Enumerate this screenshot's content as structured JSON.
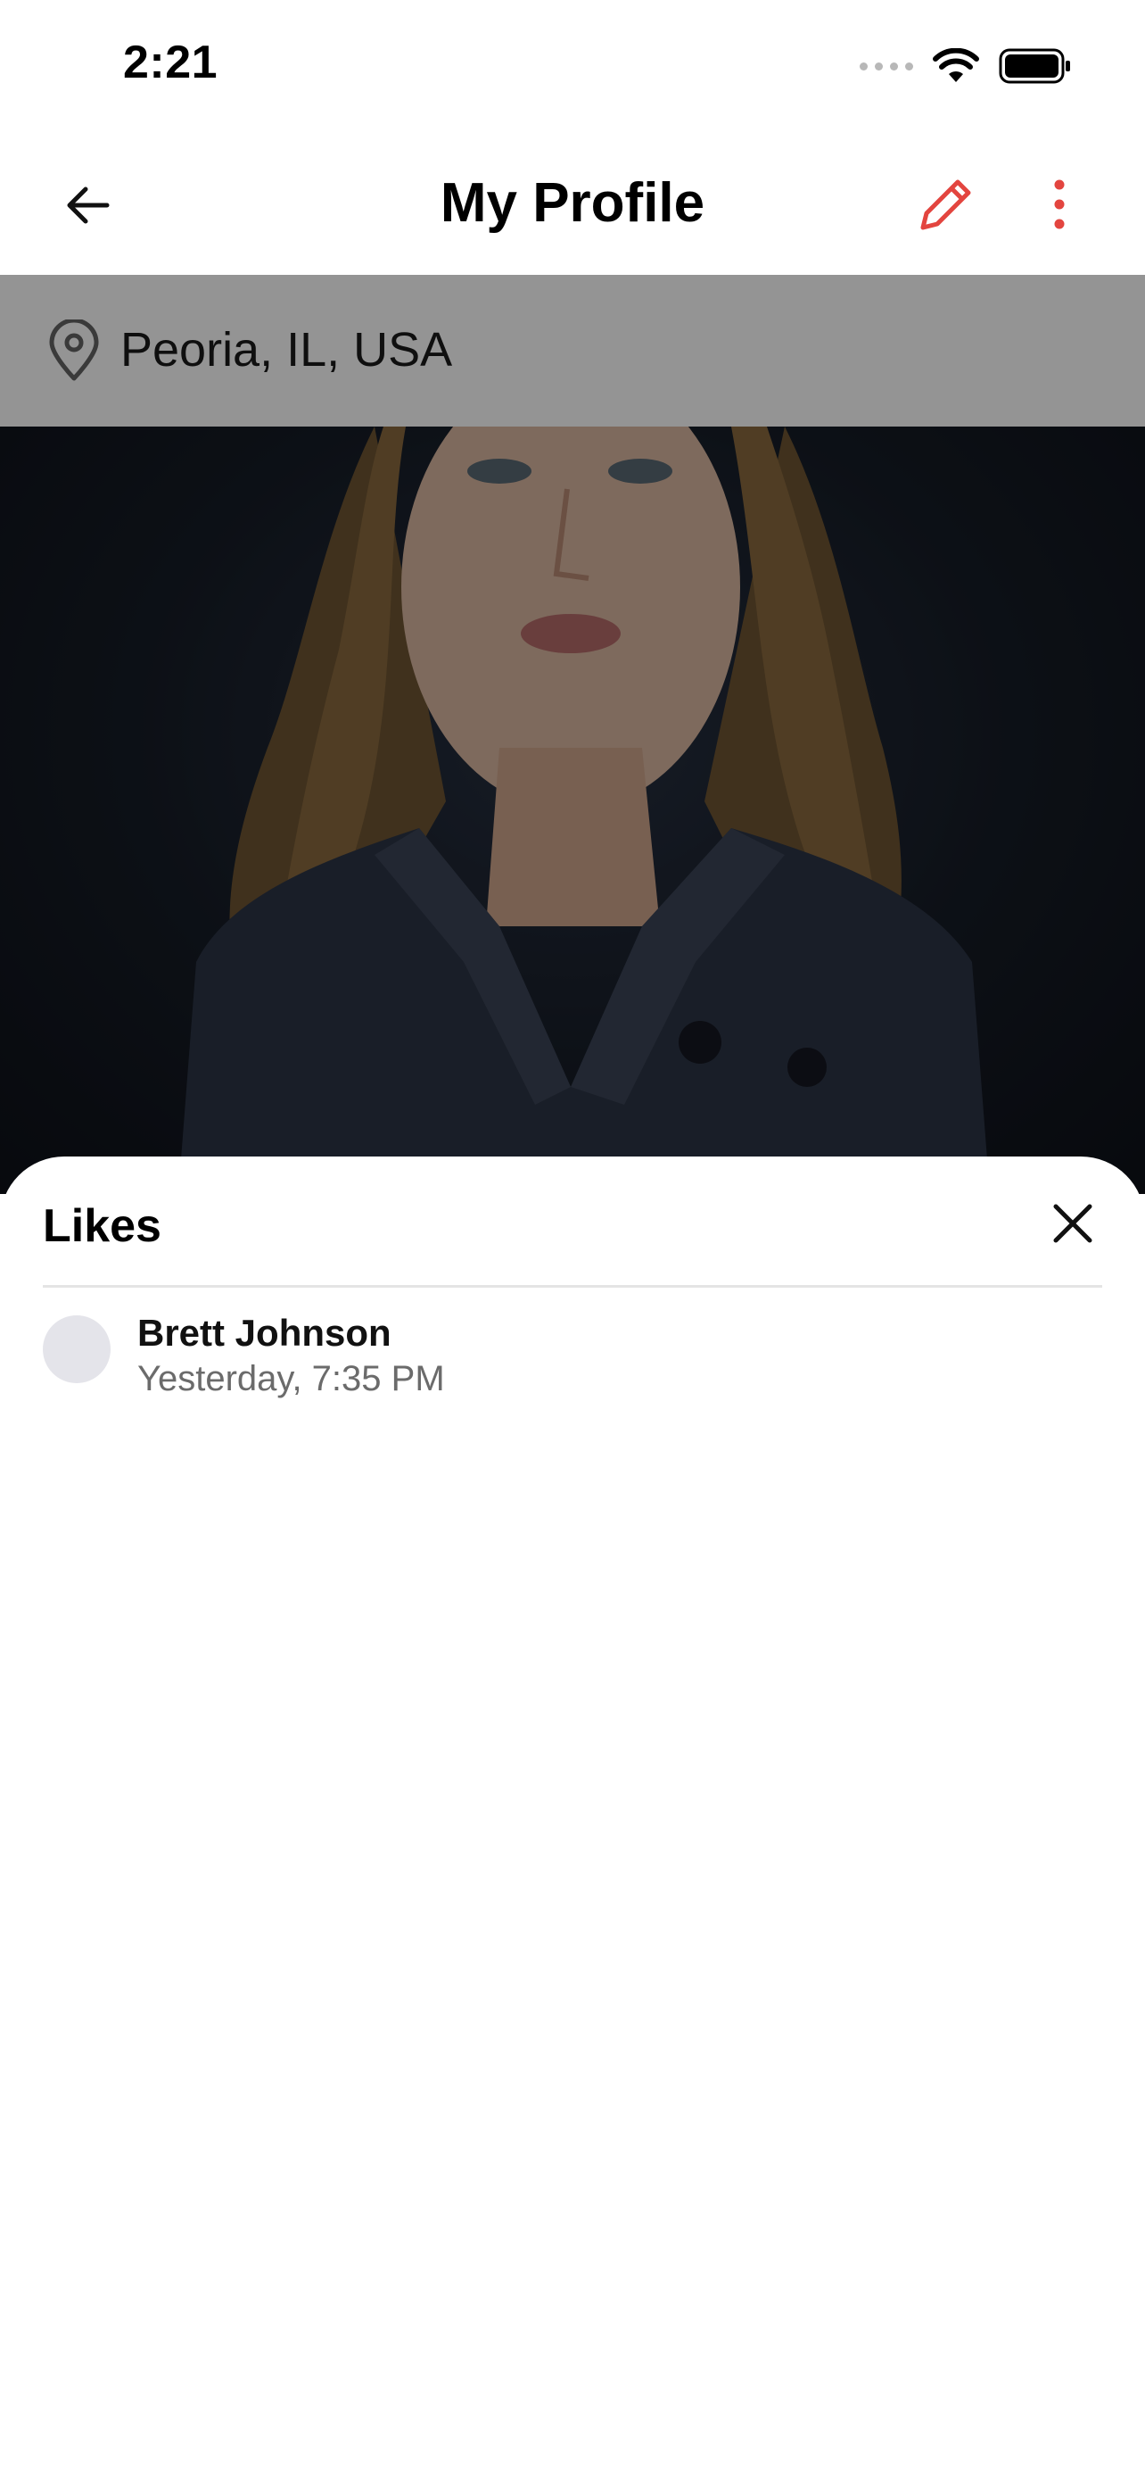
{
  "status_bar": {
    "time": "2:21"
  },
  "nav": {
    "title": "My Profile"
  },
  "location": {
    "text": "Peoria, IL, USA"
  },
  "colors": {
    "accent": "#e3453f",
    "location_bg": "#949494",
    "sheet_bg": "#ffffff"
  },
  "icons": {
    "back": "arrow-left-icon",
    "edit": "pencil-icon",
    "more": "more-vertical-icon",
    "location": "map-pin-icon",
    "close": "close-icon"
  },
  "likes_sheet": {
    "title": "Likes",
    "items": [
      {
        "name": "Brett Johnson",
        "time": "Yesterday, 7:35 PM"
      }
    ]
  }
}
